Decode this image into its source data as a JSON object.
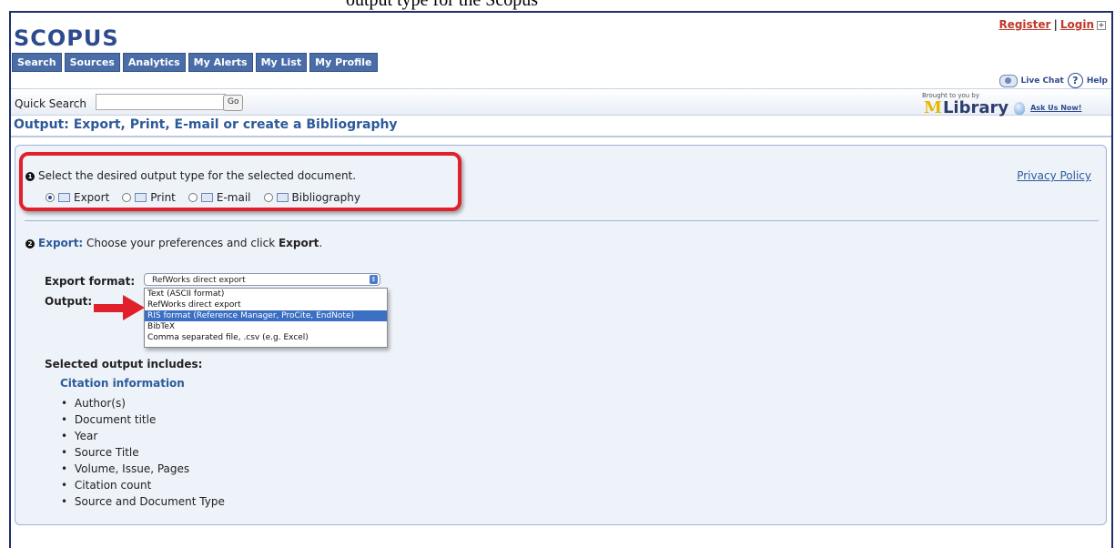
{
  "app": {
    "logo_text": "SCOPUS",
    "cut_text": "output type for the Scopus"
  },
  "auth": {
    "register": "Register",
    "separator": "|",
    "login": "Login"
  },
  "nav": {
    "tabs": [
      {
        "label": "Search"
      },
      {
        "label": "Sources"
      },
      {
        "label": "Analytics"
      },
      {
        "label": "My Alerts"
      },
      {
        "label": "My List"
      },
      {
        "label": "My Profile"
      }
    ]
  },
  "help": {
    "live_chat": "Live Chat",
    "help": "Help"
  },
  "quick_search": {
    "label": "Quick Search",
    "value": "",
    "go": "Go"
  },
  "library": {
    "brought": "Brought to you by",
    "name": "Library",
    "ask": "Ask Us Now!"
  },
  "page": {
    "title": "Output: Export, Print, E-mail or create a Bibliography"
  },
  "step1": {
    "number": "1",
    "text": "Select the desired output type for the selected document.",
    "options": [
      {
        "label": "Export",
        "selected": true
      },
      {
        "label": "Print",
        "selected": false
      },
      {
        "label": "E-mail",
        "selected": false
      },
      {
        "label": "Bibliography",
        "selected": false
      }
    ],
    "privacy": "Privacy Policy"
  },
  "step2": {
    "number": "2",
    "link": "Export:",
    "text_before": " Choose your preferences and click ",
    "text_bold": "Export",
    "text_after": "."
  },
  "export": {
    "format_label": "Export format:",
    "selected_value": "RefWorks direct export",
    "output_label": "Output:",
    "options": [
      {
        "label": "Text (ASCII format)",
        "highlighted": false
      },
      {
        "label": "RefWorks direct export",
        "highlighted": false
      },
      {
        "label": "RIS format (Reference Manager, ProCite, EndNote)",
        "highlighted": true
      },
      {
        "label": "BibTeX",
        "highlighted": false
      },
      {
        "label": "Comma separated file, .csv (e.g. Excel)",
        "highlighted": false
      }
    ]
  },
  "includes": {
    "title": "Selected output includes:",
    "subtitle": "Citation information",
    "items": [
      "Author(s)",
      "Document title",
      "Year",
      "Source Title",
      "Volume, Issue, Pages",
      "Citation count",
      "Source and Document Type"
    ]
  },
  "colors": {
    "accent": "#2d5a9b",
    "nav": "#4a6da7",
    "highlight": "#e0202a"
  }
}
